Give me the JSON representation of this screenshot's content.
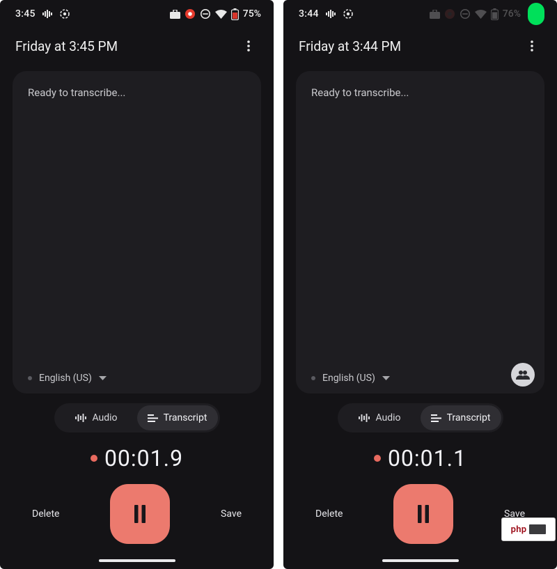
{
  "phones": [
    {
      "status": {
        "clock": "3:45",
        "battery_pct": "75%",
        "dimmed": false,
        "pill": false
      },
      "header": {
        "title": "Friday at 3:45 PM"
      },
      "panel": {
        "placeholder": "Ready to transcribe...",
        "language": "English (US)",
        "people_button": false
      },
      "tabs": {
        "audio": "Audio",
        "transcript": "Transcript",
        "active": "transcript"
      },
      "timer": "00:01.9",
      "controls": {
        "delete": "Delete",
        "save": "Save"
      }
    },
    {
      "status": {
        "clock": "3:44",
        "battery_pct": "76%",
        "dimmed": true,
        "pill": true
      },
      "header": {
        "title": "Friday at 3:44 PM"
      },
      "panel": {
        "placeholder": "Ready to transcribe...",
        "language": "English (US)",
        "people_button": true
      },
      "tabs": {
        "audio": "Audio",
        "transcript": "Transcript",
        "active": "transcript"
      },
      "timer": "00:01.1",
      "controls": {
        "delete": "Delete",
        "save": "Save"
      }
    }
  ],
  "watermark": "php"
}
